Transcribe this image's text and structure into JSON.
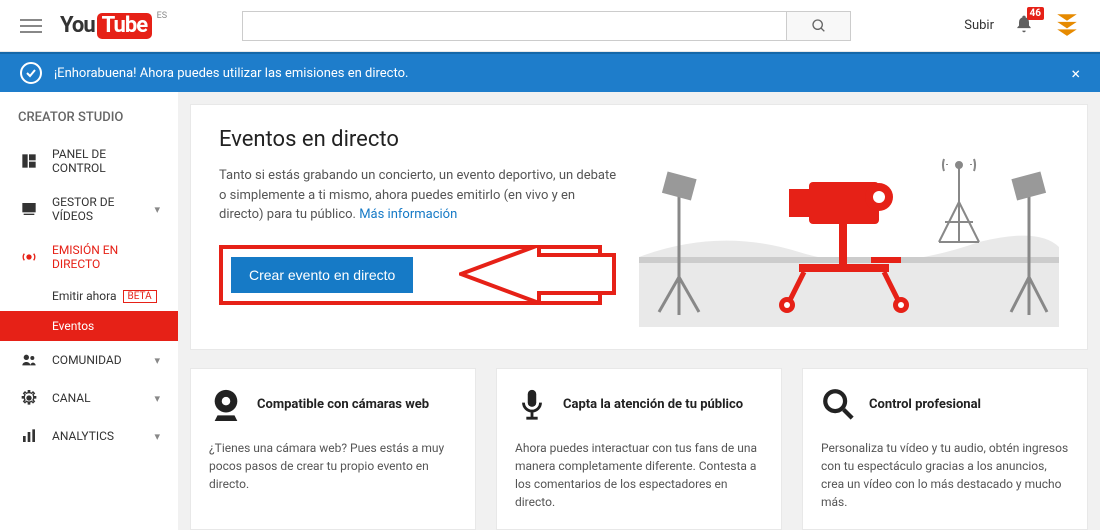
{
  "header": {
    "logo_you": "You",
    "logo_tube": "Tube",
    "logo_sup": "ES",
    "upload_label": "Subir",
    "notif_count": "46"
  },
  "banner": {
    "text": "¡Enhorabuena! Ahora puedes utilizar las emisiones en directo.",
    "close": "×"
  },
  "sidebar": {
    "title": "CREATOR STUDIO",
    "dashboard": "PANEL DE CONTROL",
    "video_manager": "GESTOR DE VÍDEOS",
    "live": "EMISIÓN EN DIRECTO",
    "live_now": "Emitir ahora",
    "beta": "BETA",
    "events": "Eventos",
    "community": "COMUNIDAD",
    "channel": "CANAL",
    "analytics": "ANALYTICS"
  },
  "hero": {
    "title": "Eventos en directo",
    "text": "Tanto si estás grabando un concierto, un evento deportivo, un debate o simplemente a ti mismo, ahora puedes emitirlo (en vivo y en directo) para tu público. ",
    "more": "Más información",
    "cta": "Crear evento en directo"
  },
  "features": [
    {
      "title": "Compatible con cámaras web",
      "text": "¿Tienes una cámara web? Pues estás a muy pocos pasos de crear tu propio evento en directo."
    },
    {
      "title": "Capta la atención de tu público",
      "text": "Ahora puedes interactuar con tus fans de una manera completamente diferente. Contesta a los comentarios de los espectadores en directo."
    },
    {
      "title": "Control profesional",
      "text": "Personaliza tu vídeo y tu audio, obtén ingresos con tu espectáculo gracias a los anuncios, crea un vídeo con lo más destacado y mucho más."
    }
  ]
}
